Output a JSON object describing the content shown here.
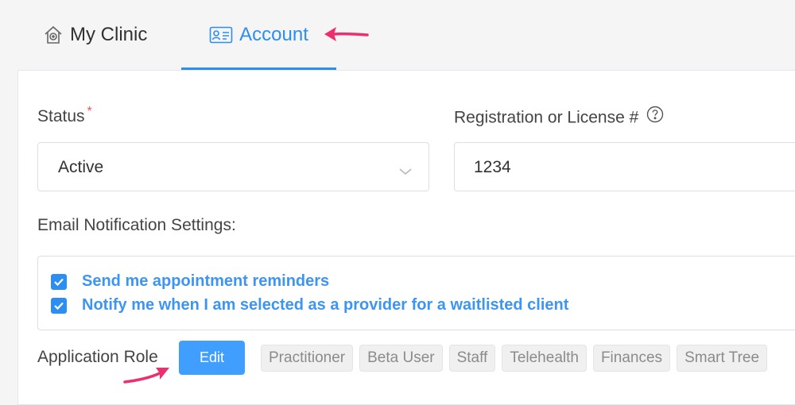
{
  "tabs": [
    {
      "label": "My Clinic",
      "icon": "clinic-house-icon"
    },
    {
      "label": "Account",
      "icon": "id-card-icon",
      "active": true
    }
  ],
  "form": {
    "status": {
      "label": "Status",
      "required_mark": "*",
      "value": "Active"
    },
    "license": {
      "label": "Registration or License #",
      "value": "1234"
    },
    "email_settings": {
      "label": "Email Notification Settings:",
      "options": [
        {
          "label": "Send me appointment reminders",
          "checked": true
        },
        {
          "label": "Notify me when I am selected as a provider for a waitlisted client",
          "checked": true
        }
      ]
    },
    "application_role": {
      "label": "Application Role",
      "edit_label": "Edit",
      "roles": [
        "Practitioner",
        "Beta User",
        "Staff",
        "Telehealth",
        "Finances",
        "Smart Tree"
      ]
    }
  },
  "colors": {
    "accent": "#2b8ef0",
    "arrow": "#ee2f6e",
    "required": "#ee5555"
  }
}
